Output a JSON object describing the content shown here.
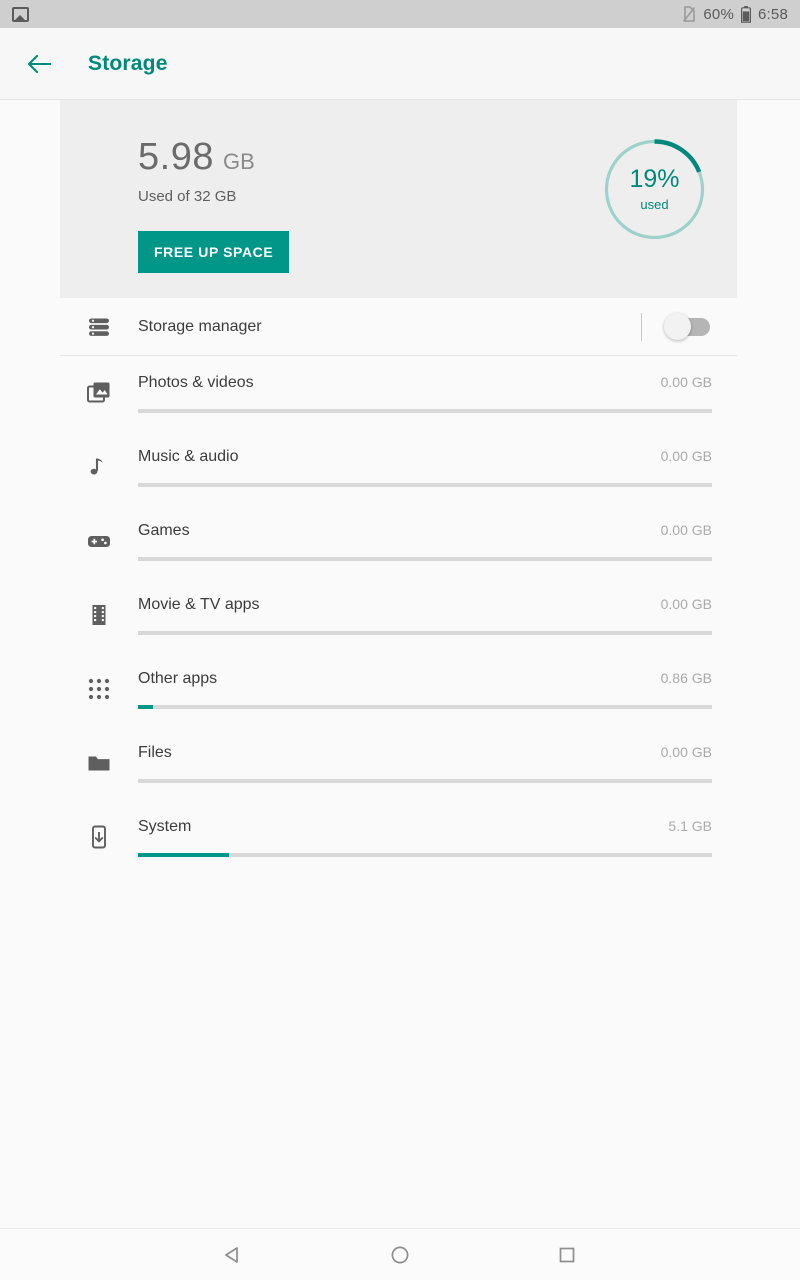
{
  "status_bar": {
    "notification_icon": "screenshot-icon",
    "no_sim_icon": "no-sim-icon",
    "battery_percent": "60%",
    "battery_icon": "battery-icon",
    "time": "6:58"
  },
  "app_bar": {
    "back_icon": "arrow-left-icon",
    "title": "Storage"
  },
  "summary": {
    "used_value": "5.98",
    "used_unit": "GB",
    "used_of": "Used of 32 GB",
    "free_button": "FREE UP SPACE",
    "ring": {
      "percent_label": "19%",
      "sub_label": "used",
      "percent_value": 19,
      "track_color": "#9cd2cb",
      "arc_color": "#00897b"
    }
  },
  "storage_manager": {
    "icon": "storage-stack-icon",
    "label": "Storage manager",
    "toggle_state": "off"
  },
  "categories": [
    {
      "icon": "photos-icon",
      "label": "Photos & videos",
      "size": "0.00 GB",
      "fill_percent": 0
    },
    {
      "icon": "music-icon",
      "label": "Music & audio",
      "size": "0.00 GB",
      "fill_percent": 0
    },
    {
      "icon": "games-icon",
      "label": "Games",
      "size": "0.00 GB",
      "fill_percent": 0
    },
    {
      "icon": "movie-icon",
      "label": "Movie & TV apps",
      "size": "0.00 GB",
      "fill_percent": 0
    },
    {
      "icon": "apps-grid-icon",
      "label": "Other apps",
      "size": "0.86 GB",
      "fill_percent": 2.7
    },
    {
      "icon": "folder-icon",
      "label": "Files",
      "size": "0.00 GB",
      "fill_percent": 0
    },
    {
      "icon": "system-icon",
      "label": "System",
      "size": "5.1 GB",
      "fill_percent": 15.8
    }
  ],
  "nav_bar": {
    "back": "nav-back-icon",
    "home": "nav-home-icon",
    "recents": "nav-recents-icon"
  },
  "colors": {
    "accent": "#009688",
    "accent_dark": "#00897b",
    "card_bg": "#eeeeee",
    "page_bg": "#fafafa"
  }
}
